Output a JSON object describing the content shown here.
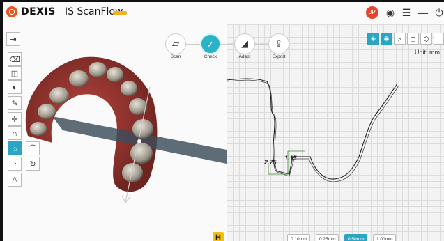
{
  "app": {
    "brand": "DEXIS",
    "title": "IS ScanFlow",
    "user_initials": "JP"
  },
  "colors": {
    "accent": "#2aa5c4",
    "brand_orange": "#e8561f",
    "brand_yellow": "#f0b31b",
    "user_badge": "#e2482d"
  },
  "window_controls": [
    "record-icon",
    "menu-icon",
    "minimize-icon",
    "power-icon"
  ],
  "workflow": {
    "steps": [
      {
        "label": "Scan",
        "icon": "scanner-icon",
        "active": false
      },
      {
        "label": "Check",
        "icon": "check-icon",
        "active": true
      },
      {
        "label": "Adapt",
        "icon": "adapt-icon",
        "active": false
      },
      {
        "label": "Export",
        "icon": "export-icon",
        "active": false
      }
    ]
  },
  "left_toolbar": {
    "items": [
      {
        "icon": "sidebar-toggle-icon"
      },
      {
        "icon": "trash-icon"
      },
      {
        "icon": "snapshot-icon"
      },
      {
        "icon": "texture-icon"
      },
      {
        "icon": "ruler-icon"
      },
      {
        "icon": "axes-icon"
      },
      {
        "icon": "arch-icon"
      },
      {
        "icon": "cross-section-icon",
        "active": true
      },
      {
        "icon": "margin-icon"
      },
      {
        "icon": "occlusion-icon"
      }
    ],
    "flyout": [
      {
        "icon": "cross-section-type-icon"
      },
      {
        "icon": "rotate-icon"
      }
    ]
  },
  "view_tools": [
    "layers-icon",
    "color-icon",
    "zoom-icon",
    "camera-icon",
    "cube-icon"
  ],
  "unit_label": "Unit: mm",
  "measurements": [
    "2.75",
    "1.15"
  ],
  "grid_sizes": [
    {
      "label": "0.10mm",
      "selected": false
    },
    {
      "label": "0.25mm",
      "selected": false
    },
    {
      "label": "0.50mm",
      "selected": true
    },
    {
      "label": "1.00mm",
      "selected": false
    }
  ],
  "help_badge": "H"
}
